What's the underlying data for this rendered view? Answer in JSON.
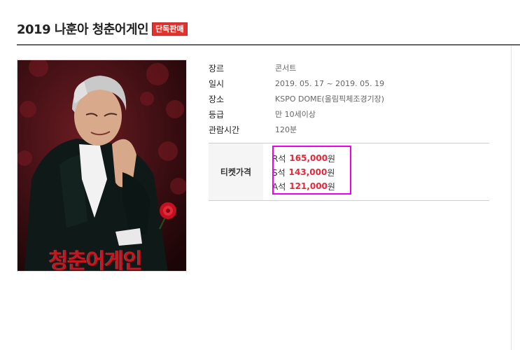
{
  "header": {
    "title": "2019 나훈아 청춘어게인",
    "badge": "단독판매"
  },
  "poster": {
    "title_text": "청춘어게인"
  },
  "info": [
    {
      "label": "장르",
      "value": "콘서트"
    },
    {
      "label": "일시",
      "value": "2019. 05. 17 ~ 2019. 05. 19"
    },
    {
      "label": "장소",
      "value": "KSPO DOME(올림픽체조경기장)"
    },
    {
      "label": "등급",
      "value": "만 10세이상"
    },
    {
      "label": "관람시간",
      "value": "120분"
    }
  ],
  "ticket": {
    "label": "티켓가격",
    "prices": [
      {
        "seat": "R석",
        "amount": "165,000",
        "unit": "원"
      },
      {
        "seat": "S석",
        "amount": "143,000",
        "unit": "원"
      },
      {
        "seat": "A석",
        "amount": "121,000",
        "unit": "원"
      }
    ]
  },
  "colors": {
    "accent": "#e5283b",
    "badge": "#e0352f",
    "highlight": "#ee00ee"
  }
}
